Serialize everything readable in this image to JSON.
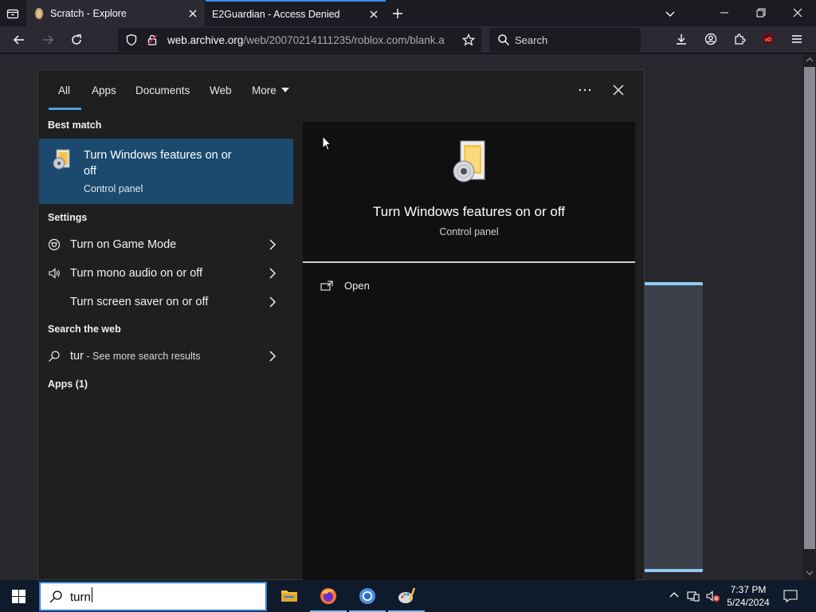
{
  "browser": {
    "tabs": [
      {
        "title": "Scratch - Explore"
      },
      {
        "title": "E2Guardian - Access Denied"
      }
    ],
    "url_domain": "web.archive.org",
    "url_rest": "/web/20070214111235/roblox.com/blank.a",
    "search_placeholder": "Search"
  },
  "flyout": {
    "filters": [
      "All",
      "Apps",
      "Documents",
      "Web",
      "More"
    ],
    "best_match_heading": "Best match",
    "best_match": {
      "title": "Turn Windows features on or off",
      "subtitle": "Control panel"
    },
    "settings_heading": "Settings",
    "settings_items": [
      {
        "label": "Turn on Game Mode",
        "icon": "game-mode-icon"
      },
      {
        "label": "Turn mono audio on or off",
        "icon": "speaker-icon"
      },
      {
        "label": "Turn screen saver on or off",
        "icon": ""
      }
    ],
    "web_heading": "Search the web",
    "web_item": {
      "query": "tur",
      "sub": " - See more search results"
    },
    "apps_heading": "Apps (1)",
    "detail": {
      "title": "Turn Windows features on or off",
      "subtitle": "Control panel",
      "open_label": "Open"
    }
  },
  "taskbar": {
    "search_query": "turn",
    "time": "7:37 PM",
    "date": "5/24/2024"
  }
}
